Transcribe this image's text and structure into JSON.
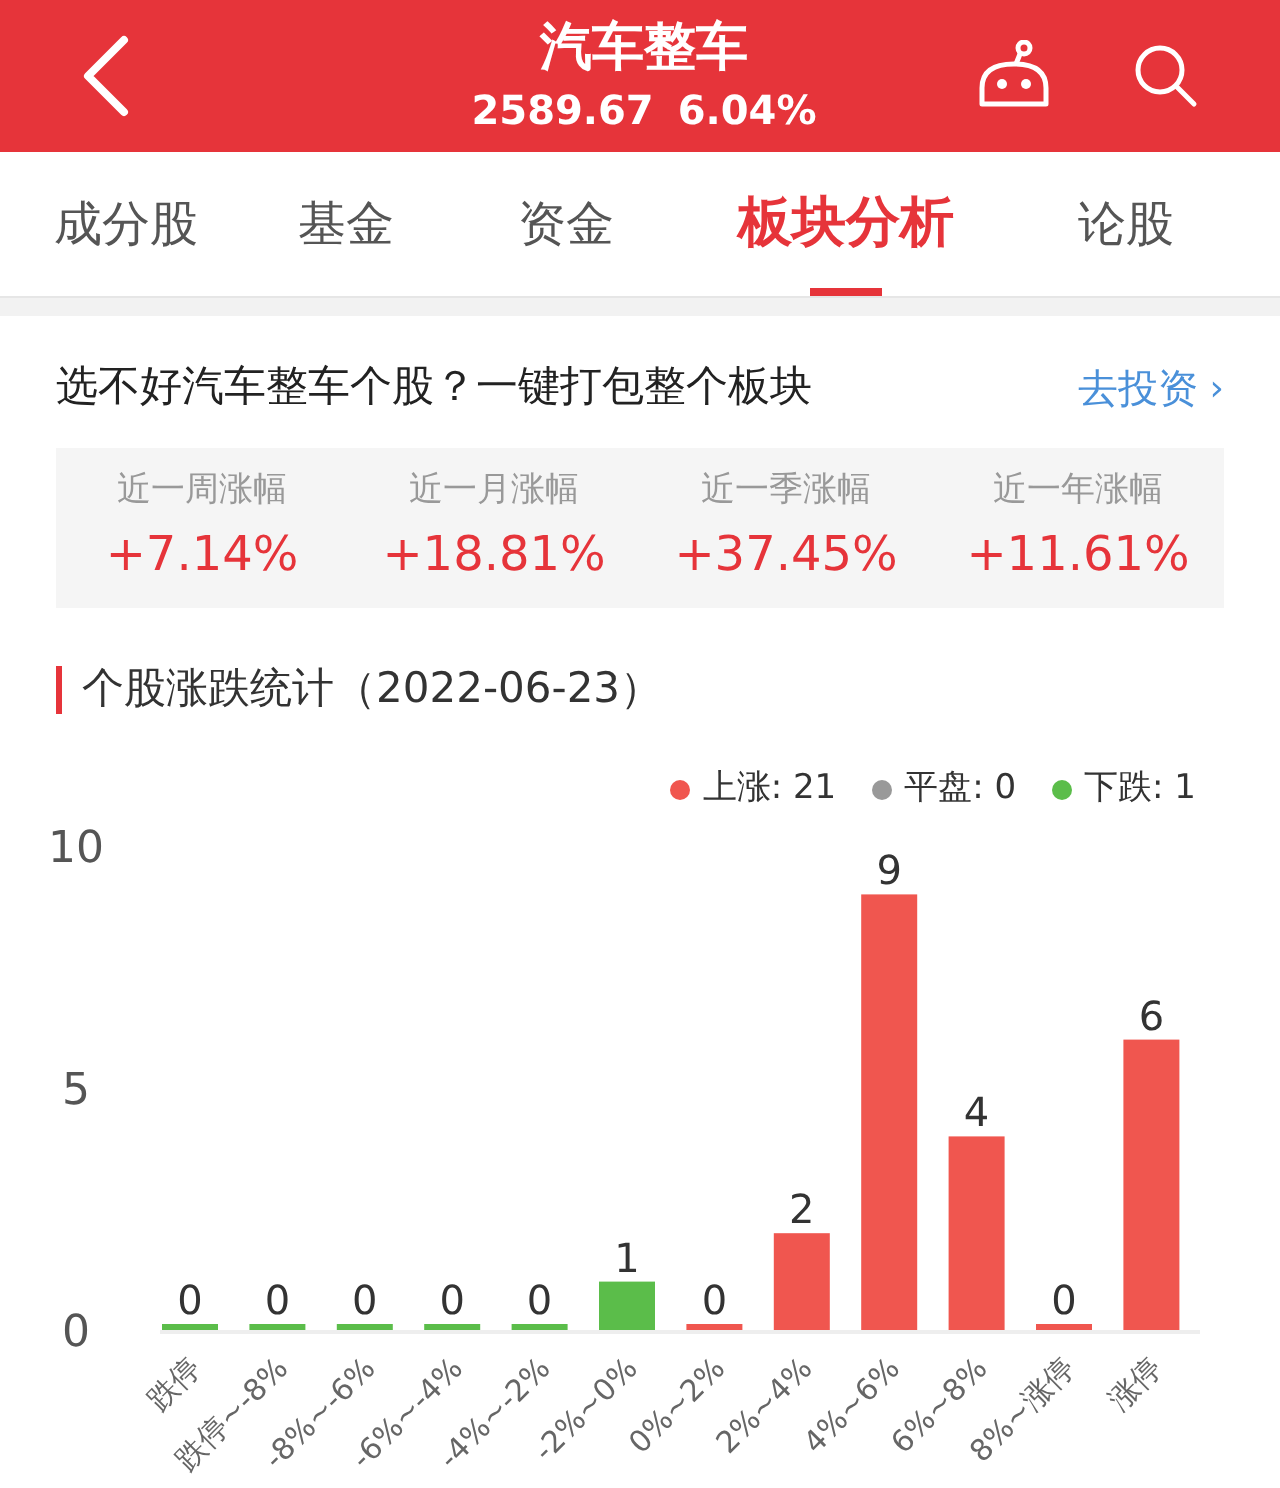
{
  "header": {
    "title": "汽车整车",
    "price": "2589.67",
    "change": "6.04%"
  },
  "tabs": [
    {
      "label": "成分股",
      "selected": false
    },
    {
      "label": "基金",
      "selected": false
    },
    {
      "label": "资金",
      "selected": false
    },
    {
      "label": "板块分析",
      "selected": true
    },
    {
      "label": "论股",
      "selected": false
    }
  ],
  "banner": {
    "text": "选不好汽车整车个股？一键打包整个板块",
    "link": "去投资",
    "link_arrow": "›"
  },
  "returns": [
    {
      "label": "近一周涨幅",
      "value": "+7.14%"
    },
    {
      "label": "近一月涨幅",
      "value": "+18.81%"
    },
    {
      "label": "近一季涨幅",
      "value": "+37.45%"
    },
    {
      "label": "近一年涨幅",
      "value": "+11.61%"
    }
  ],
  "section_title": "个股涨跌统计（2022-06-23）",
  "chart_data": {
    "type": "bar",
    "data_labels": true,
    "ylim": [
      0,
      10
    ],
    "yticks": [
      0,
      5,
      10
    ],
    "categories": [
      "跌停",
      "跌停~-8%",
      "-8%~-6%",
      "-6%~-4%",
      "-4%~-2%",
      "-2%~0%",
      "0%~2%",
      "2%~4%",
      "4%~6%",
      "6%~8%",
      "8%~涨停",
      "涨停"
    ],
    "series": [
      {
        "name": "上涨: 21",
        "color": "#f0564f",
        "values": [
          null,
          null,
          null,
          null,
          null,
          null,
          0,
          2,
          9,
          4,
          0,
          6
        ]
      },
      {
        "name": "平盘: 0",
        "color": "#999999",
        "values": [
          null,
          null,
          null,
          null,
          null,
          null,
          null,
          null,
          null,
          null,
          null,
          null
        ]
      },
      {
        "name": "下跌: 1",
        "color": "#5bbd4a",
        "values": [
          0,
          0,
          0,
          0,
          0,
          1,
          null,
          null,
          null,
          null,
          null,
          null
        ]
      }
    ]
  }
}
